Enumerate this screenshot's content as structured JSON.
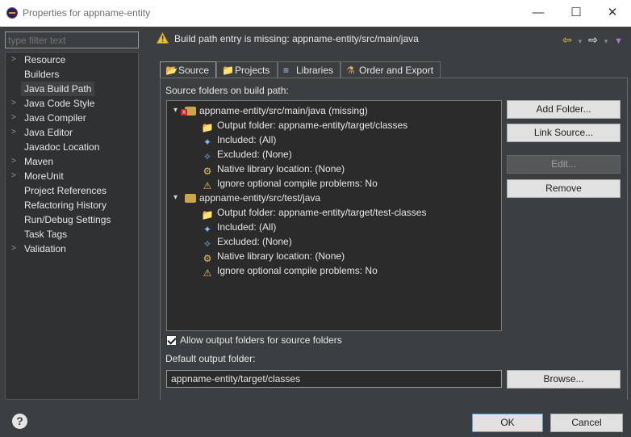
{
  "window": {
    "title": "Properties for appname-entity",
    "minimize_glyph": "—",
    "maximize_glyph": "☐",
    "close_glyph": "✕"
  },
  "filter": {
    "placeholder": "type filter text"
  },
  "sidebar": {
    "items": [
      {
        "label": "Resource",
        "expandable": true
      },
      {
        "label": "Builders",
        "expandable": false
      },
      {
        "label": "Java Build Path",
        "expandable": false,
        "selected": true
      },
      {
        "label": "Java Code Style",
        "expandable": true
      },
      {
        "label": "Java Compiler",
        "expandable": true
      },
      {
        "label": "Java Editor",
        "expandable": true
      },
      {
        "label": "Javadoc Location",
        "expandable": false
      },
      {
        "label": "Maven",
        "expandable": true
      },
      {
        "label": "MoreUnit",
        "expandable": true
      },
      {
        "label": "Project References",
        "expandable": false
      },
      {
        "label": "Refactoring History",
        "expandable": false
      },
      {
        "label": "Run/Debug Settings",
        "expandable": false
      },
      {
        "label": "Task Tags",
        "expandable": false
      },
      {
        "label": "Validation",
        "expandable": true
      }
    ]
  },
  "header": {
    "message": "Build path entry is missing: appname-entity/src/main/java",
    "icons": [
      "back-arrow-icon",
      "forward-arrow-icon",
      "view-menu-icon"
    ]
  },
  "tabs": [
    {
      "label": "Source",
      "icon": "source-folder-icon",
      "active": true
    },
    {
      "label": "Projects",
      "icon": "projects-icon",
      "active": false
    },
    {
      "label": "Libraries",
      "icon": "libraries-icon",
      "active": false
    },
    {
      "label": "Order and Export",
      "icon": "order-export-icon",
      "active": false
    }
  ],
  "source": {
    "section_label": "Source folders on build path:",
    "folders": [
      {
        "path": "appname-entity/src/main/java (missing)",
        "missing": true,
        "children": [
          "Output folder: appname-entity/target/classes",
          "Included: (All)",
          "Excluded: (None)",
          "Native library location: (None)",
          "Ignore optional compile problems: No"
        ]
      },
      {
        "path": "appname-entity/src/test/java",
        "missing": false,
        "children": [
          "Output folder: appname-entity/target/test-classes",
          "Included: (All)",
          "Excluded: (None)",
          "Native library location: (None)",
          "Ignore optional compile problems: No"
        ]
      }
    ],
    "buttons": {
      "add_folder": "Add Folder...",
      "link_source": "Link Source...",
      "edit": "Edit...",
      "remove": "Remove",
      "browse": "Browse..."
    },
    "allow_output_label": "Allow output folders for source folders",
    "allow_output_checked": true,
    "default_output_label": "Default output folder:",
    "default_output_value": "appname-entity/target/classes"
  },
  "footer": {
    "ok": "OK",
    "cancel": "Cancel"
  },
  "colors": {
    "background": "#3c3f41",
    "tree_background": "#2b2b2b",
    "button": "#e1e1e1",
    "warning": "#f0c040",
    "error": "#d0252a"
  }
}
